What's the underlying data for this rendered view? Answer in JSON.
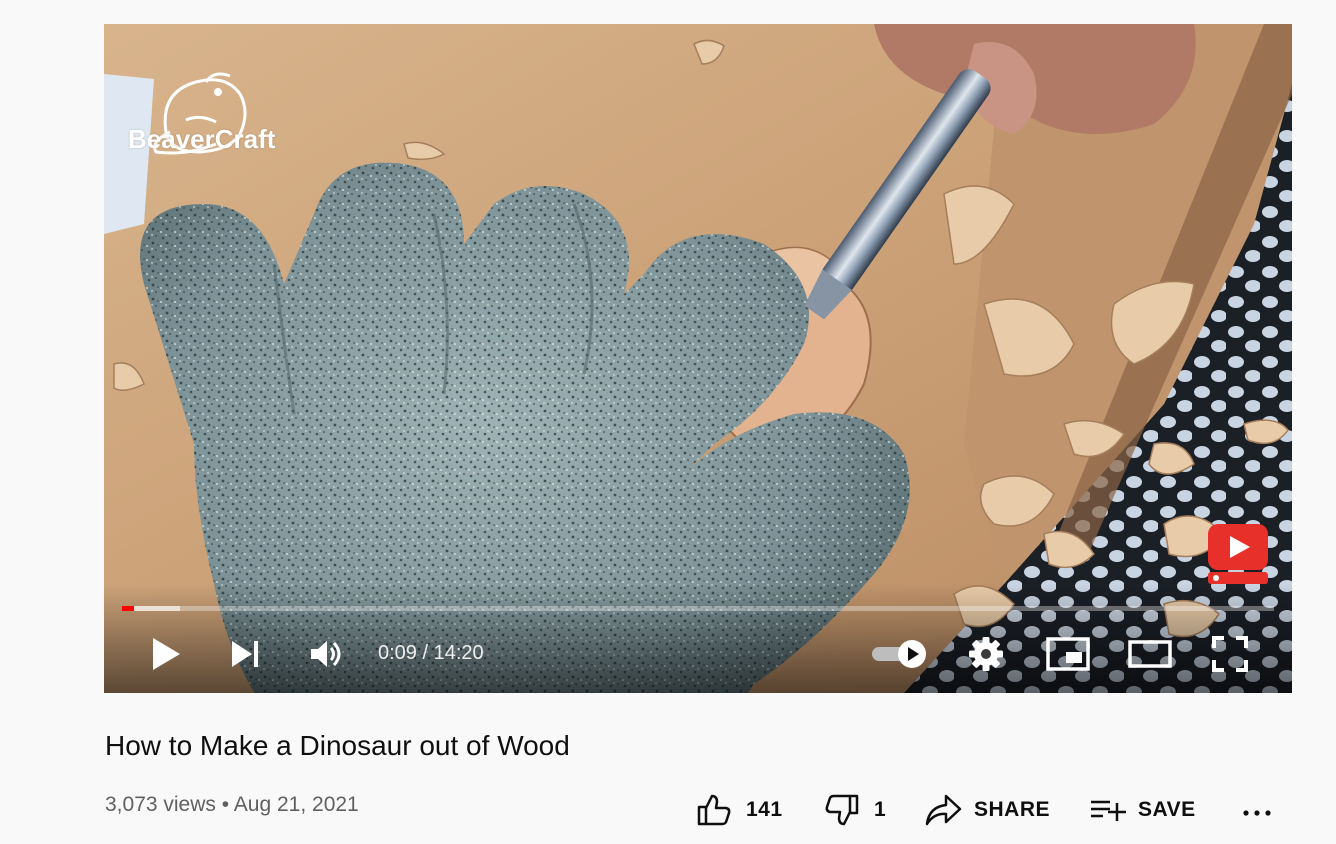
{
  "video": {
    "channel_watermark": "BeaverCraft",
    "current_time": "0:09",
    "duration": "14:20",
    "progress": 0.0105,
    "buffered": 0.05,
    "autoplay_on": true
  },
  "title": "How to Make a Dinosaur out of Wood",
  "meta": {
    "views": "3,073 views",
    "separator": "•",
    "date": "Aug 21, 2021"
  },
  "actions": {
    "likes": "141",
    "dislikes": "1",
    "share": "SHARE",
    "save": "SAVE",
    "more": "..."
  },
  "icons": [
    "play-icon",
    "next-icon",
    "volume-icon",
    "autoplay-toggle-icon",
    "settings-gear-icon",
    "miniplayer-icon",
    "theater-mode-icon",
    "fullscreen-icon",
    "like-icon",
    "dislike-icon",
    "share-icon",
    "save-playlist-icon",
    "more-icon",
    "youtube-logo-icon"
  ],
  "colors": {
    "accent": "#ff0000",
    "text_primary": "#0f0f0f",
    "text_secondary": "#606060",
    "background": "#f9f9f9"
  }
}
